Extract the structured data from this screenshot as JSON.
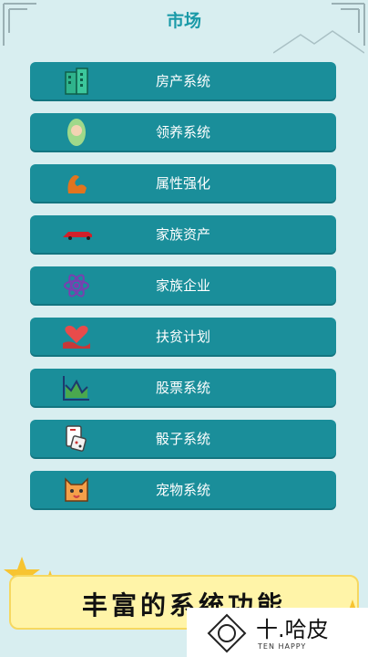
{
  "page": {
    "title": "市场"
  },
  "menu": {
    "items": [
      {
        "label": "房产系统",
        "icon": "building-icon"
      },
      {
        "label": "领养系统",
        "icon": "baby-icon"
      },
      {
        "label": "属性强化",
        "icon": "flexed-arm-icon"
      },
      {
        "label": "家族资产",
        "icon": "red-car-icon"
      },
      {
        "label": "家族企业",
        "icon": "atom-icon"
      },
      {
        "label": "扶贫计划",
        "icon": "heart-hand-icon"
      },
      {
        "label": "股票系统",
        "icon": "stock-chart-icon"
      },
      {
        "label": "骰子系统",
        "icon": "dice-cards-icon"
      },
      {
        "label": "宠物系统",
        "icon": "pet-face-icon"
      }
    ]
  },
  "banner": {
    "text": "丰富的系统功能"
  },
  "watermark": {
    "name": "十.哈皮",
    "sub": "TEN HAPPY"
  },
  "colors": {
    "button": "#1a8e9a",
    "title": "#1a9aa8",
    "background": "#d8eef0",
    "banner": "#fff4a8"
  }
}
